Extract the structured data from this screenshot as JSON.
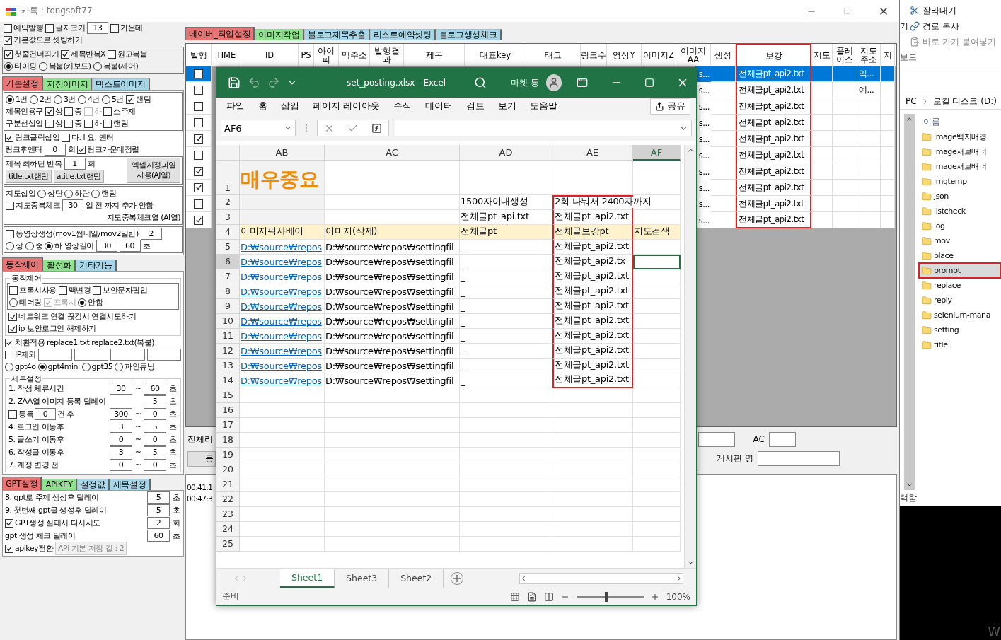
{
  "app": {
    "title": "카톡 : tongsoft77"
  },
  "left_panel": [
    {
      "kind": "plain",
      "rows": [
        {
          "items": [
            {
              "kind": "check",
              "label": "예약발행",
              "checked": false,
              "disabled": false
            },
            {
              "kind": "check",
              "label": "글자크기",
              "checked": false,
              "disabled": false
            },
            {
              "kind": "input",
              "value": "13"
            },
            {
              "kind": "check",
              "label": "가운데",
              "checked": false,
              "disabled": false
            }
          ]
        },
        {
          "items": [
            {
              "kind": "check",
              "label": "기본값으로 셋팅하기",
              "checked": true,
              "disabled": false
            }
          ]
        }
      ]
    },
    {
      "kind": "box",
      "rows": [
        {
          "items": [
            {
              "kind": "check",
              "label": "첫줄건너띄기",
              "checked": true,
              "disabled": false
            },
            {
              "kind": "check",
              "label": "제목반복X",
              "checked": true,
              "disabled": false
            },
            {
              "kind": "check",
              "label": "원고복붙",
              "checked": false,
              "disabled": false
            }
          ]
        },
        {
          "items": [
            {
              "kind": "radio",
              "label": "타이핑",
              "selected": true
            },
            {
              "kind": "radio",
              "label": "복붙(키보드)",
              "selected": false
            },
            {
              "kind": "radio",
              "label": "복붙(제어)",
              "selected": false
            }
          ]
        }
      ]
    },
    {
      "kind": "tabs",
      "tabs": [
        {
          "label": "기본설정",
          "color": "#e87474",
          "selected": true
        },
        {
          "label": "지정이미지",
          "color": "#8fe38f",
          "selected": false
        },
        {
          "label": "텍스트이미지",
          "color": "#a9d6e6",
          "selected": false
        }
      ],
      "sections": [
        {
          "kind": "box",
          "rows": [
            {
              "items": [
                {
                  "kind": "radio",
                  "label": "1번",
                  "selected": true
                },
                {
                  "kind": "radio",
                  "label": "2번",
                  "selected": false
                },
                {
                  "kind": "radio",
                  "label": "3번",
                  "selected": false
                },
                {
                  "kind": "radio",
                  "label": "4번",
                  "selected": false
                },
                {
                  "kind": "radio",
                  "label": "5번",
                  "selected": false
                },
                {
                  "kind": "check",
                  "label": "랜덤",
                  "checked": true,
                  "disabled": false
                }
              ]
            },
            {
              "items": [
                {
                  "kind": "text",
                  "text": "제목인용구"
                },
                {
                  "kind": "check",
                  "label": "상",
                  "checked": true,
                  "disabled": false
                },
                {
                  "kind": "check",
                  "label": "중",
                  "checked": false,
                  "disabled": false
                },
                {
                  "kind": "check",
                  "label": "하",
                  "checked": false,
                  "disabled": true
                },
                {
                  "kind": "check",
                  "label": "소주제",
                  "checked": false,
                  "disabled": false
                }
              ]
            },
            {
              "items": [
                {
                  "kind": "text",
                  "text": "구분선삽입"
                },
                {
                  "kind": "check",
                  "label": "상",
                  "checked": false,
                  "disabled": false
                },
                {
                  "kind": "check",
                  "label": "중",
                  "checked": false,
                  "disabled": false
                },
                {
                  "kind": "check",
                  "label": "하",
                  "checked": false,
                  "disabled": false
                },
                {
                  "kind": "check",
                  "label": "랜덤",
                  "checked": false,
                  "disabled": false
                }
              ]
            }
          ]
        },
        {
          "kind": "plain",
          "rows": [
            {
              "items": [
                {
                  "kind": "check",
                  "label": "링크클릭삽입",
                  "checked": true,
                  "disabled": false
                },
                {
                  "kind": "check",
                  "label": "다. l 요. 엔터",
                  "checked": false,
                  "disabled": false
                }
              ]
            },
            {
              "items": [
                {
                  "kind": "text",
                  "text": "링크후엔터"
                },
                {
                  "kind": "input",
                  "value": "0"
                },
                {
                  "kind": "text",
                  "text": "회"
                },
                {
                  "kind": "check",
                  "label": "링크가운데정렬",
                  "checked": true,
                  "disabled": false
                }
              ]
            }
          ]
        },
        {
          "kind": "box",
          "rows": [
            {
              "items": [
                {
                  "kind": "text",
                  "text": "제목 최하단 반복"
                },
                {
                  "kind": "input",
                  "value": "1"
                },
                {
                  "kind": "text",
                  "text": "회"
                }
              ]
            },
            {
              "items": [
                {
                  "kind": "button",
                  "label": "title.txt랜덤"
                },
                {
                  "kind": "button",
                  "label": "atitle.txt랜덤"
                }
              ]
            }
          ],
          "aside": {
            "kind": "button",
            "label": "엑셀지정파일 사용(AJ열)"
          }
        },
        {
          "kind": "box",
          "rows": [
            {
              "items": [
                {
                  "kind": "text",
                  "text": "지도삽입"
                },
                {
                  "kind": "radio",
                  "label": "상단",
                  "selected": false
                },
                {
                  "kind": "radio",
                  "label": "하단",
                  "selected": false
                },
                {
                  "kind": "radio",
                  "label": "랜덤",
                  "selected": false
                }
              ]
            },
            {
              "items": [
                {
                  "kind": "check",
                  "label": "지도중복체크",
                  "checked": false,
                  "disabled": false
                },
                {
                  "kind": "input",
                  "value": "30"
                },
                {
                  "kind": "text",
                  "text": "일 전 까지 추가 안함"
                }
              ]
            },
            {
              "items": [
                {
                  "kind": "caption",
                  "text": "지도중복체크열 (AI열)"
                }
              ]
            }
          ]
        },
        {
          "kind": "box",
          "rows": [
            {
              "items": [
                {
                  "kind": "check",
                  "label": "동영상생성(mov1썸네일/mov2일반)",
                  "checked": false,
                  "disabled": false
                },
                {
                  "kind": "input",
                  "value": "2"
                }
              ]
            },
            {
              "items": [
                {
                  "kind": "radio",
                  "label": "상",
                  "selected": false
                },
                {
                  "kind": "radio",
                  "label": "중",
                  "selected": false
                },
                {
                  "kind": "radio",
                  "label": "하",
                  "selected": true
                },
                {
                  "kind": "text",
                  "text": "영상길이"
                },
                {
                  "kind": "input",
                  "value": "30"
                },
                {
                  "kind": "input",
                  "value": "60"
                },
                {
                  "kind": "text",
                  "text": "초"
                }
              ]
            }
          ]
        }
      ]
    },
    {
      "kind": "tabs",
      "tabs": [
        {
          "label": "동작제어",
          "color": "#e87474",
          "selected": true
        },
        {
          "label": "활성화",
          "color": "#8fe38f",
          "selected": false
        },
        {
          "label": "기타기능",
          "color": "#a9d6e6",
          "selected": false
        }
      ],
      "sections": [
        {
          "kind": "group",
          "title": "동작제어",
          "sections": [
            {
              "kind": "box",
              "rows": [
                {
                  "items": [
                    {
                      "kind": "check",
                      "label": "프록시사용",
                      "checked": false,
                      "disabled": false
                    },
                    {
                      "kind": "check",
                      "label": "맥변경",
                      "checked": false,
                      "disabled": false
                    },
                    {
                      "kind": "check",
                      "label": "보안문자팝업",
                      "checked": false,
                      "disabled": false
                    }
                  ]
                },
                {
                  "items": [
                    {
                      "kind": "radio",
                      "label": "테더링",
                      "selected": false
                    },
                    {
                      "kind": "check",
                      "label": "프록시",
                      "checked": true,
                      "disabled": true
                    },
                    {
                      "kind": "radio",
                      "label": "안함",
                      "selected": true
                    }
                  ]
                }
              ]
            },
            {
              "kind": "plain",
              "rows": [
                {
                  "items": [
                    {
                      "kind": "check",
                      "label": "네트워크 연결 끊김시 연결시도하기",
                      "checked": true,
                      "disabled": false
                    }
                  ]
                },
                {
                  "items": [
                    {
                      "kind": "check",
                      "label": "ip 보안로그인 해제하기",
                      "checked": true,
                      "disabled": false
                    }
                  ]
                }
              ]
            }
          ]
        },
        {
          "kind": "plain",
          "rows": [
            {
              "items": [
                {
                  "kind": "check",
                  "label": "치환적용 replace1.txt replace2.txt(복붙)",
                  "checked": true,
                  "disabled": false
                }
              ]
            },
            {
              "items": [
                {
                  "kind": "check",
                  "label": "IP제외",
                  "checked": false,
                  "disabled": false
                },
                {
                  "kind": "input"
                },
                {
                  "kind": "input"
                },
                {
                  "kind": "input"
                },
                {
                  "kind": "input"
                }
              ]
            },
            {
              "items": [
                {
                  "kind": "radio",
                  "label": "gpt4o",
                  "selected": false
                },
                {
                  "kind": "radio",
                  "label": "gpt4mini",
                  "selected": true
                },
                {
                  "kind": "radio",
                  "label": "gpt35",
                  "selected": false
                },
                {
                  "kind": "radio",
                  "label": "파인튜닝",
                  "selected": false
                }
              ]
            }
          ]
        },
        {
          "kind": "group",
          "title": "세부설정",
          "sections": [
            {
              "kind": "delays",
              "rows": [
                {
                  "label": "1. 작성 체류시간",
                  "from": "30",
                  "sep": "~",
                  "to": "60",
                  "unit": "초"
                },
                {
                  "label": "2. ZAA열 이미지 등록 딜레이",
                  "to": "5",
                  "unit": "초"
                },
                {
                  "label": "등록",
                  "checked": false,
                  "count": "0",
                  "count_unit": "건 후",
                  "from": "300",
                  "sep": "~",
                  "to": "0",
                  "unit": "초"
                },
                {
                  "label": "4. 로그인 이동후",
                  "from": "3",
                  "sep": "~",
                  "to": "5",
                  "unit": "초"
                },
                {
                  "label": "5. 글쓰기 이동후",
                  "from": "0",
                  "sep": "~",
                  "to": "0",
                  "unit": "초"
                },
                {
                  "label": "6. 작성글 이동후",
                  "from": "3",
                  "sep": "~",
                  "to": "5",
                  "unit": "초"
                },
                {
                  "label": "7. 계정 변경 전",
                  "from": "0",
                  "sep": "~",
                  "to": "0",
                  "unit": "초"
                }
              ]
            }
          ]
        }
      ]
    },
    {
      "kind": "tabs",
      "tabs": [
        {
          "label": "GPT설정",
          "color": "#e87474",
          "selected": true
        },
        {
          "label": "APIKEY",
          "color": "#8fe38f",
          "selected": false
        },
        {
          "label": "설정값",
          "color": "#a9d6e6",
          "selected": false
        },
        {
          "label": "제목설정",
          "color": "#a9d6e6",
          "selected": false
        }
      ],
      "sections": [
        {
          "kind": "delays",
          "rows": [
            {
              "label": "8. gpt로 주제 생성후 딜레이",
              "to": "5",
              "unit": "초"
            },
            {
              "label": "9. 첫번째 gpt글 생성후 딜레이",
              "to": "5",
              "unit": "초"
            },
            {
              "label": "GPT생성 실패시 다시시도",
              "checked": true,
              "to": "2",
              "unit": "회"
            },
            {
              "label": "gpt 생성 체크 딜레이",
              "to": "60",
              "unit": "초"
            }
          ]
        },
        {
          "kind": "plain",
          "rows": [
            {
              "items": [
                {
                  "kind": "check",
                  "label": "apikey전환",
                  "checked": true,
                  "disabled": false
                },
                {
                  "kind": "note",
                  "text": "API 기본 저장 값 : 2"
                }
              ]
            }
          ]
        }
      ]
    }
  ],
  "main_tabs": [
    {
      "label": "네이버_작업설정",
      "color": "#e87474",
      "selected": true
    },
    {
      "label": "이미지작업",
      "color": "#8fe38f",
      "selected": false
    },
    {
      "label": "블로그제목추출",
      "color": "#a9d6e6",
      "selected": false
    },
    {
      "label": "리스트예약셋팅",
      "color": "#a9d6e6",
      "selected": false
    },
    {
      "label": "블로그생성체크",
      "color": "#a9d6e6",
      "selected": false
    }
  ],
  "grid": {
    "columns": [
      {
        "label": "발행",
        "highlighted": false
      },
      {
        "label": "TIME",
        "highlighted": false
      },
      {
        "label": "ID",
        "highlighted": false
      },
      {
        "label": "PS",
        "highlighted": false
      },
      {
        "label": "아이피",
        "highlighted": false
      },
      {
        "label": "맥주소",
        "highlighted": false
      },
      {
        "label": "발행결과",
        "highlighted": false
      },
      {
        "label": "제목",
        "highlighted": false
      },
      {
        "label": "대표key",
        "highlighted": false
      },
      {
        "label": "태그",
        "highlighted": false
      },
      {
        "label": "링크수",
        "highlighted": false
      },
      {
        "label": "영상Y",
        "highlighted": false
      },
      {
        "label": "이미지Z",
        "highlighted": false
      },
      {
        "label": "이미지AA",
        "highlighted": false
      },
      {
        "label": "생성",
        "highlighted": false
      },
      {
        "label": "보강",
        "highlighted": true
      },
      {
        "label": "지도",
        "highlighted": false
      },
      {
        "label": "플레이스",
        "highlighted": false
      },
      {
        "label": "지도주소",
        "highlighted": false
      },
      {
        "label": "지",
        "highlighted": false
      }
    ],
    "rows": [
      {
        "selected": true,
        "published": false,
        "image_aa": "s...",
        "boost": "전체글pt_api2.txt",
        "map_address": "익..."
      },
      {
        "selected": false,
        "published": false,
        "image_aa": "s...",
        "boost": "전체글pt_api2.txt",
        "map_address": "예..."
      },
      {
        "selected": false,
        "published": false,
        "image_aa": "s...",
        "boost": "전체글pt_api2.txt"
      },
      {
        "selected": false,
        "published": false,
        "image_aa": "s...",
        "boost": "전체글pt_api2.txt"
      },
      {
        "selected": false,
        "published": true,
        "image_aa": "s...",
        "boost": "전체글pt_api2.txt"
      },
      {
        "selected": false,
        "published": false,
        "image_aa": "s...",
        "boost": "전체글pt_api2.txt"
      },
      {
        "selected": false,
        "published": true,
        "image_aa": "s...",
        "boost": "전체글pt_api2.txt"
      },
      {
        "selected": false,
        "published": true,
        "image_aa": "s...",
        "boost": "전체글pt_api2.txt"
      },
      {
        "selected": false,
        "published": false,
        "image_aa": "s...",
        "boost": "전체글pt_api2.txt"
      },
      {
        "selected": false,
        "published": true,
        "image_aa": "s...",
        "boost": "전체글pt_api2.txt"
      }
    ]
  },
  "bottom": {
    "cut_label": "전체리",
    "cut_button": "등",
    "ac_label": "AC",
    "board_label": "게시판 명",
    "log_lines": [
      "00:41:1",
      "00:47:3"
    ]
  },
  "excel": {
    "title": "set_posting.xlsx  -  Excel",
    "user": "마켓 통",
    "menu": [
      "파일",
      "홈",
      "삽입",
      "페이지 레이아웃",
      "수식",
      "데이터",
      "검토",
      "보기",
      "도움말"
    ],
    "share": "공유",
    "name_box": "AF6",
    "columns": [
      {
        "label": "AB",
        "selected": false,
        "highlighted": false
      },
      {
        "label": "AC",
        "selected": false,
        "highlighted": false
      },
      {
        "label": "AD",
        "selected": false,
        "highlighted": false
      },
      {
        "label": "AE",
        "selected": false,
        "highlighted": true
      },
      {
        "label": "AF",
        "selected": true,
        "highlighted": false
      }
    ],
    "rows": [
      {
        "number": "1",
        "kind": "title",
        "selected": false,
        "highlighted": false,
        "ab": "매우중요"
      },
      {
        "number": "2",
        "kind": "note",
        "selected": false,
        "highlighted": true,
        "ad": "1500자이내생성",
        "ae": "2회 나눠서 2400자까지"
      },
      {
        "number": "3",
        "kind": "note",
        "selected": false,
        "highlighted": true,
        "ad": "전체글pt_api.txt",
        "ae": "전체글pt_api2.txt"
      },
      {
        "number": "4",
        "kind": "header",
        "selected": false,
        "highlighted": true,
        "ab": "이미지픽사베이",
        "ac": "이미지(삭제)",
        "ad": "전체글pt",
        "ae": "전체글보강pt",
        "af": "지도검색"
      },
      {
        "number": "5",
        "kind": "data",
        "selected": false,
        "highlighted": true,
        "ab": "D:₩source₩repos",
        "ac": "D:₩source₩repos₩settingfil",
        "ad": "_",
        "ae": "전체글pt_api2.txt"
      },
      {
        "number": "6",
        "kind": "data",
        "selected": true,
        "highlighted": true,
        "ab": "D:₩source₩repos",
        "ac": "D:₩source₩repos₩settingfil",
        "ad": "_",
        "ae": "전체글pt_api2.tx"
      },
      {
        "number": "7",
        "kind": "data",
        "selected": false,
        "highlighted": true,
        "ab": "D:₩source₩repos",
        "ac": "D:₩source₩repos₩settingfil",
        "ad": "_",
        "ae": "전체글pt_api2.txt"
      },
      {
        "number": "8",
        "kind": "data",
        "selected": false,
        "highlighted": true,
        "ab": "D:₩source₩repos",
        "ac": "D:₩source₩repos₩settingfil",
        "ad": "_",
        "ae": "전체글pt_api2.txt"
      },
      {
        "number": "9",
        "kind": "data",
        "selected": false,
        "highlighted": true,
        "ab": "D:₩source₩repos",
        "ac": "D:₩source₩repos₩settingfil",
        "ad": "_",
        "ae": "전체글pt_api2.txt"
      },
      {
        "number": "10",
        "kind": "data",
        "selected": false,
        "highlighted": true,
        "ab": "D:₩source₩repos",
        "ac": "D:₩source₩repos₩settingfil",
        "ad": "_",
        "ae": "전체글pt_api2.txt"
      },
      {
        "number": "11",
        "kind": "data",
        "selected": false,
        "highlighted": true,
        "ab": "D:₩source₩repos",
        "ac": "D:₩source₩repos₩settingfil",
        "ad": "_",
        "ae": "전체글pt_api2.txt"
      },
      {
        "number": "12",
        "kind": "data",
        "selected": false,
        "highlighted": true,
        "ab": "D:₩source₩repos",
        "ac": "D:₩source₩repos₩settingfil",
        "ad": "_",
        "ae": "전체글pt_api2.txt"
      },
      {
        "number": "13",
        "kind": "data",
        "selected": false,
        "highlighted": true,
        "ab": "D:₩source₩repos",
        "ac": "D:₩source₩repos₩settingfil",
        "ad": "_",
        "ae": "전체글pt_api2.txt"
      },
      {
        "number": "14",
        "kind": "data",
        "selected": false,
        "highlighted": true,
        "ab": "D:₩source₩repos",
        "ac": "D:₩source₩repos₩settingfil",
        "ad": "_",
        "ae": "전체글pt_api2.txt"
      },
      {
        "number": "15",
        "kind": "empty",
        "selected": false,
        "highlighted": false
      },
      {
        "number": "16",
        "kind": "empty",
        "selected": false,
        "highlighted": false
      },
      {
        "number": "17",
        "kind": "empty",
        "selected": false,
        "highlighted": false
      },
      {
        "number": "18",
        "kind": "empty",
        "selected": false,
        "highlighted": false
      },
      {
        "number": "19",
        "kind": "empty",
        "selected": false,
        "highlighted": false
      },
      {
        "number": "20",
        "kind": "empty",
        "selected": false,
        "highlighted": false
      },
      {
        "number": "21",
        "kind": "empty",
        "selected": false,
        "highlighted": false
      },
      {
        "number": "22",
        "kind": "empty",
        "selected": false,
        "highlighted": false
      },
      {
        "number": "23",
        "kind": "empty",
        "selected": false,
        "highlighted": false
      },
      {
        "number": "24",
        "kind": "empty",
        "selected": false,
        "highlighted": false
      },
      {
        "number": "25",
        "kind": "empty",
        "selected": false,
        "highlighted": false
      }
    ],
    "sheets": [
      {
        "label": "Sheet1",
        "selected": true
      },
      {
        "label": "Sheet3",
        "selected": false
      },
      {
        "label": "Sheet2",
        "selected": false
      }
    ],
    "status": "준비",
    "zoom": {
      "label": "100%",
      "level": 0.45
    }
  },
  "explorer": {
    "edge_text": "기",
    "ribbon": [
      "잘라내기",
      "경로 복사",
      "바로 가기 붙여넣기"
    ],
    "ribbon_group": "보드",
    "path": [
      "PC",
      "로컬 디스크 (D:)"
    ],
    "column": "이름",
    "folders": [
      {
        "name": "image백지배경",
        "selected": false
      },
      {
        "name": "image서브배너",
        "selected": false
      },
      {
        "name": "image서브배너",
        "selected": false
      },
      {
        "name": "imgtemp",
        "selected": false
      },
      {
        "name": "json",
        "selected": false
      },
      {
        "name": "listcheck",
        "selected": false
      },
      {
        "name": "log",
        "selected": false
      },
      {
        "name": "mov",
        "selected": false
      },
      {
        "name": "place",
        "selected": false
      },
      {
        "name": "prompt",
        "selected": true
      },
      {
        "name": "replace",
        "selected": false
      },
      {
        "name": "reply",
        "selected": false
      },
      {
        "name": "selenium-mana",
        "selected": false
      },
      {
        "name": "setting",
        "selected": false
      },
      {
        "name": "title",
        "selected": false
      }
    ],
    "status": "택함"
  },
  "desktop_text": "W"
}
